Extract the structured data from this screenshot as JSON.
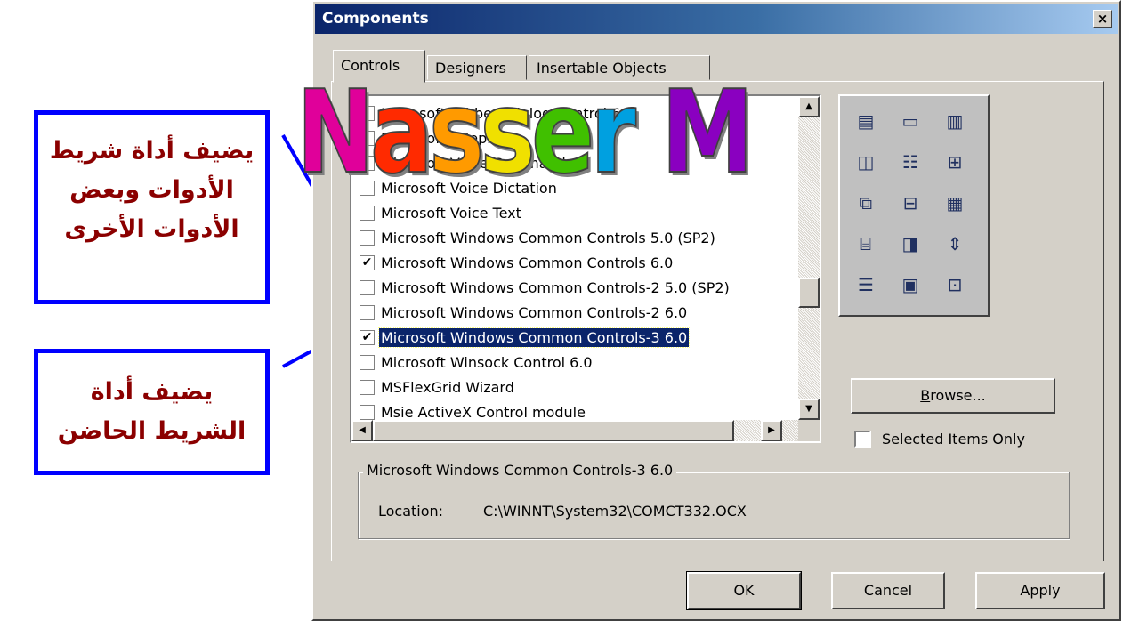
{
  "annotations": {
    "box1": [
      "يضيف أداة شريط",
      "الأدوات وبعض",
      "الأدوات الأخرى"
    ],
    "box2": [
      "يضيف أداة",
      "الشريط الحاضن"
    ]
  },
  "dialog": {
    "title": "Components",
    "close_glyph": "×",
    "tabs": [
      "Controls",
      "Designers",
      "Insertable Objects"
    ],
    "active_tab": "Controls",
    "list_items": [
      {
        "label": "Microsoft Tabbed Dialog Control 6.0",
        "checked": false
      },
      {
        "label": "Microsoft Telephony",
        "checked": false
      },
      {
        "label": "Microsoft Voice Commands",
        "checked": false
      },
      {
        "label": "Microsoft Voice Dictation",
        "checked": false
      },
      {
        "label": "Microsoft Voice Text",
        "checked": false
      },
      {
        "label": "Microsoft Windows Common Controls 5.0 (SP2)",
        "checked": false
      },
      {
        "label": "Microsoft Windows Common Controls 6.0",
        "checked": true
      },
      {
        "label": "Microsoft Windows Common Controls-2 5.0 (SP2)",
        "checked": false
      },
      {
        "label": "Microsoft Windows Common Controls-2 6.0",
        "checked": false
      },
      {
        "label": "Microsoft Windows Common Controls-3 6.0",
        "checked": true,
        "selected": true
      },
      {
        "label": "Microsoft Winsock Control 6.0",
        "checked": false
      },
      {
        "label": "MSFlexGrid Wizard",
        "checked": false
      },
      {
        "label": "Msie ActiveX Control module",
        "checked": false
      }
    ],
    "check_glyph": "✔",
    "browse_label": "Browse...",
    "selected_only_label": "Selected Items Only",
    "selected_only_checked": false,
    "details_title": "Microsoft Windows Common Controls-3 6.0",
    "location_label": "Location:",
    "location_value": "C:\\WINNT\\System32\\COMCT332.OCX",
    "buttons": {
      "ok": "OK",
      "cancel": "Cancel",
      "apply": "Apply"
    }
  },
  "watermark": {
    "letters": [
      "N",
      "a",
      "s",
      "s",
      "e",
      "r",
      " ",
      "M"
    ],
    "colors": [
      "#e0009a",
      "#ff2a00",
      "#ff9a00",
      "#f0e000",
      "#40c000",
      "#00a0e0",
      "#ffffff",
      "#8a00c0"
    ]
  },
  "preview_icons": [
    "toolbar-icon",
    "statusbar-icon",
    "progressbar-icon",
    "tabstrip-icon",
    "listview-icon",
    "treeview-icon",
    "imagelist-icon",
    "slider-icon",
    "imagecombo-icon",
    "coolbar-icon",
    "animation-icon",
    "updown-icon",
    "flatscrollbar-icon",
    "datepicker-icon",
    "monthview-icon"
  ]
}
